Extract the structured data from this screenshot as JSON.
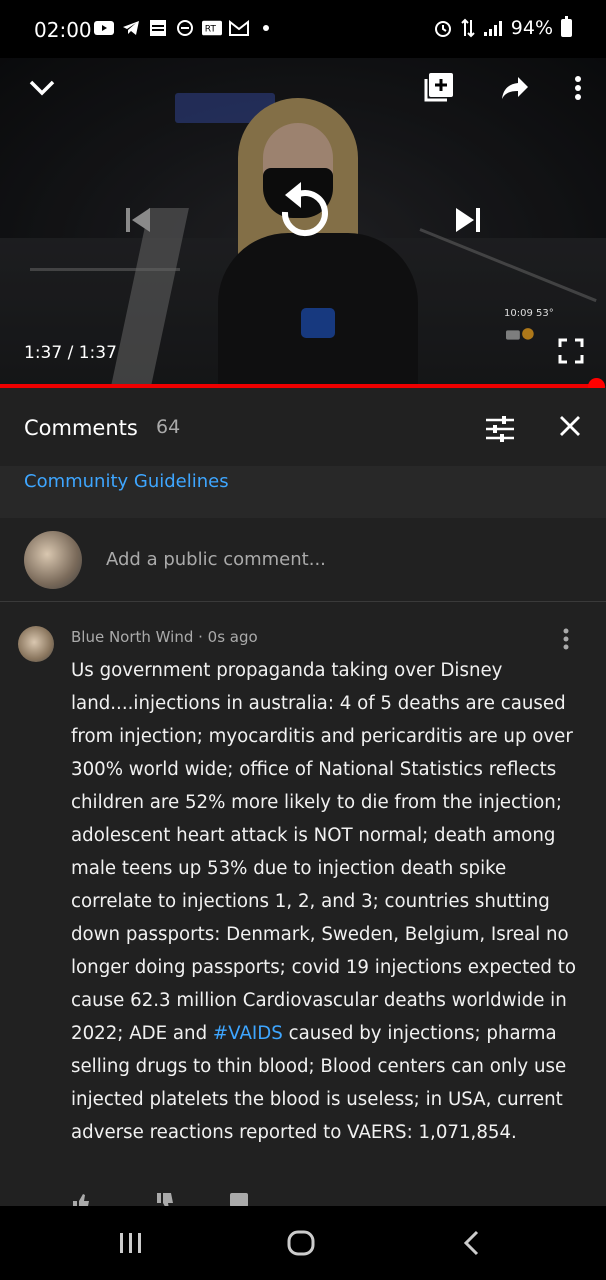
{
  "status_bar": {
    "time": "02:00",
    "battery": "94%",
    "icons": [
      "youtube-icon",
      "telegram-icon",
      "news-icon",
      "minus-circle-icon",
      "rt-icon",
      "gmail-icon",
      "dot-icon"
    ],
    "right_icons": [
      "alarm-icon",
      "data-icon",
      "signal-icon",
      "battery-icon"
    ]
  },
  "player": {
    "elapsed": "1:37",
    "separator": " / ",
    "duration": "1:37",
    "progress": 1.0,
    "overlay_time": "10:09 53°",
    "accent": "#ff0000"
  },
  "comments": {
    "title": "Comments",
    "count": "64",
    "guidelines": "Community Guidelines",
    "placeholder": "Add a public comment...",
    "items": [
      {
        "author_line": "Blue North Wind · 0s ago",
        "text_before": "Us government propaganda taking over Disney land....injections in australia: 4 of 5 deaths are caused from injection; myocarditis and pericarditis are up over 300% world wide; office of National Statistics reflects children are 52% more likely to die from the injection;  adolescent heart attack is NOT normal; death among male teens up 53% due to injection death spike correlate to injections 1, 2, and 3; countries shutting down passports: Denmark, Sweden, Belgium, Isreal no longer doing passports; covid 19 injections expected to cause 62.3 million Cardiovascular deaths worldwide in 2022; ADE and ",
        "hashtag": "#VAIDS",
        "text_after": " caused by injections;  pharma selling drugs to thin blood; Blood centers can only use injected platelets the blood is useless; in USA, current adverse reactions reported to VAERS: 1,071,854."
      }
    ]
  },
  "colors": {
    "link": "#3ea6ff",
    "background": "#212121"
  }
}
